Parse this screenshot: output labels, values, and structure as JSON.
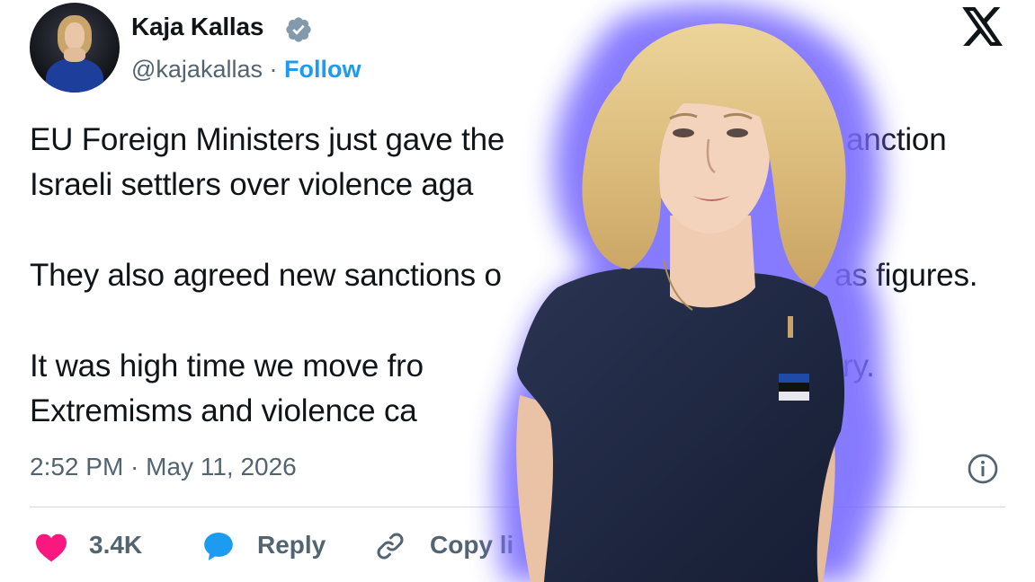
{
  "author": {
    "name": "Kaja Kallas",
    "handle": "@kajakallas",
    "separator": "·",
    "follow_label": "Follow",
    "verified_icon": "verified-badge-icon",
    "verified_color": "#829aab"
  },
  "platform": {
    "logo_icon": "x-logo-icon"
  },
  "tweet": {
    "lines": [
      "EU Foreign Ministers just gave the",
      "anction",
      "Israeli settlers over violence aga",
      "They also agreed new sanctions o",
      "as figures.",
      "It was high time we move fro",
      "ry.",
      "Extremisms and violence ca"
    ]
  },
  "timestamp": "2:52 PM · May 11, 2026",
  "actions": {
    "like_count": "3.4K",
    "reply_label": "Reply",
    "copy_label": "Copy li"
  },
  "colors": {
    "accent": "#1d9bf0",
    "text": "#0f1419",
    "muted": "#536471",
    "like": "#f91880",
    "glow": "#7a6cff"
  }
}
